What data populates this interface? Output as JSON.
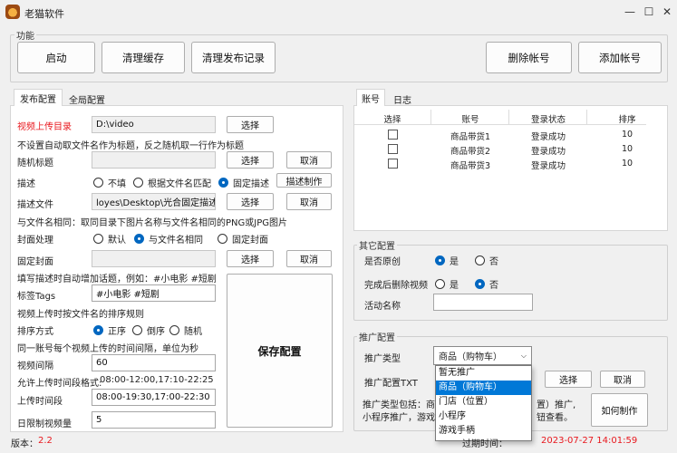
{
  "window": {
    "title": "老猫软件",
    "minimize_glyph": "—",
    "maximize_glyph": "☐",
    "close_glyph": "✕"
  },
  "function_group": {
    "legend": "功能",
    "start": "启动",
    "clear_cache": "清理缓存",
    "clear_publish_log": "清理发布记录",
    "delete_account": "删除帐号",
    "add_account": "添加帐号"
  },
  "left_tabs": [
    "发布配置",
    "全局配置"
  ],
  "publish": {
    "video_dir_label": "视频上传目录",
    "video_dir_value": "D:\\video",
    "video_dir_select": "选择",
    "note_title": "不设置自动取文件名作为标题，反之随机取一行作为标题",
    "random_title_label": "随机标题",
    "random_title_value": "",
    "random_title_select": "选择",
    "random_title_cancel": "取消",
    "desc_label": "描述",
    "desc_opt_none": "不填",
    "desc_opt_filename": "根据文件名匹配",
    "desc_opt_fixed": "固定描述",
    "desc_make": "描述制作",
    "desc_file_label": "描述文件",
    "desc_file_value": "loyes\\Desktop\\光合固定描述.txt",
    "desc_file_select": "选择",
    "desc_file_cancel": "取消",
    "note_cover": "与文件名相同：取同目录下图片名称与文件名相同的PNG或JPG图片",
    "cover_label": "封面处理",
    "cover_opt_default": "默认",
    "cover_opt_same": "与文件名相同",
    "cover_opt_fixed": "固定封面",
    "fixed_cover_label": "固定封面",
    "fixed_cover_value": "",
    "fixed_cover_select": "选择",
    "fixed_cover_cancel": "取消",
    "note_tags": "填写描述时自动增加话题，例如：#小电影 #短剧",
    "tags_label": "标签Tags",
    "tags_value": "#小电影 #短剧",
    "note_sort": "视频上传时按文件名的排序规则",
    "sort_label": "排序方式",
    "sort_opt_asc": "正序",
    "sort_opt_desc": "倒序",
    "sort_opt_random": "随机",
    "note_interval": "同一账号每个视频上传的时间间隔，单位为秒",
    "interval_label": "视频间隔",
    "interval_value": "60",
    "allowed_format_label": "允许上传时间段格式:",
    "allowed_format_value": "08:00-12:00,17:10-22:25",
    "upload_period_label": "上传时间段",
    "upload_period_value": "08:00-19:30,17:00-22:30",
    "daily_limit_label": "日限制视频量",
    "daily_limit_value": "5",
    "save_config": "保存配置"
  },
  "right_tabs": [
    "账号",
    "日志"
  ],
  "accounts": {
    "columns": [
      "选择",
      "账号",
      "登录状态",
      "排序"
    ],
    "rows": [
      {
        "account": "商品带货1",
        "status": "登录成功",
        "order": "10"
      },
      {
        "account": "商品带货2",
        "status": "登录成功",
        "order": "10"
      },
      {
        "account": "商品带货3",
        "status": "登录成功",
        "order": "10"
      }
    ]
  },
  "other_config": {
    "legend": "其它配置",
    "original_label": "是否原创",
    "original_yes": "是",
    "original_no": "否",
    "delete_after_label": "完成后删除视频",
    "delete_yes": "是",
    "delete_no": "否",
    "activity_label": "活动名称",
    "activity_value": ""
  },
  "promo": {
    "legend": "推广配置",
    "type_label": "推广类型",
    "type_selected": "商品（购物车）",
    "options": [
      "暂无推广",
      "商品（购物车）",
      "门店（位置）",
      "小程序",
      "游戏手柄"
    ],
    "selected_index": 1,
    "txt_label": "推广配置TXT",
    "txt_select": "选择",
    "txt_cancel": "取消",
    "desc_line1_a": "推广类型包括：商品",
    "desc_line1_b": "置）推广,",
    "desc_line2_a": "小程序推广，游戏手",
    "desc_line2_b": "钮查看。",
    "how_to": "如何制作"
  },
  "status_bar": {
    "version_label": "版本：",
    "version": "2.2",
    "expire_label": "过期时间：",
    "expire": "2023-07-27 14:01:59"
  },
  "colors": {
    "required_label": "#e8181e",
    "status_text": "#e8181e",
    "accent": "#0067c0",
    "selected_item": "#0078d7"
  }
}
